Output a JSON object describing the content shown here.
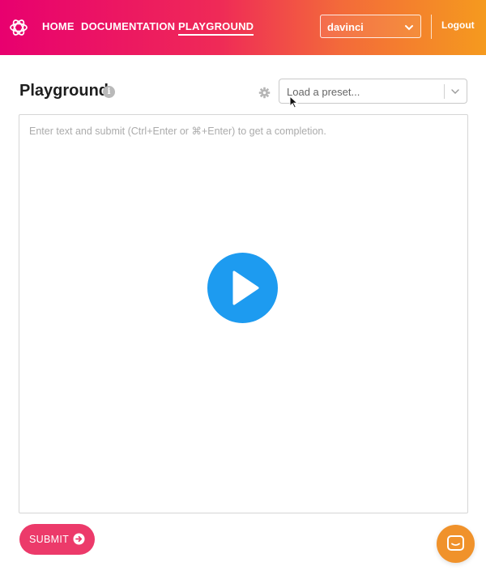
{
  "nav": {
    "links": [
      "HOME",
      "DOCUMENTATION",
      "PLAYGROUND"
    ],
    "active": "PLAYGROUND",
    "model": "davinci",
    "logout": "Logout"
  },
  "page": {
    "title": "Playground",
    "info_icon_glyph": "i",
    "preset_placeholder": "Load a preset..."
  },
  "editor": {
    "placeholder": "Enter text and submit (Ctrl+Enter or ⌘+Enter) to get a completion.",
    "value": ""
  },
  "actions": {
    "submit_label": "SUBMIT"
  },
  "colors": {
    "accent_pink": "#ec3a6a",
    "play_blue": "#1d9bf0",
    "chat_orange": "#f0922b"
  },
  "icons": [
    "openai-logo-icon",
    "chevron-down-icon",
    "info-icon",
    "gear-icon",
    "play-icon",
    "arrow-right-circle-icon",
    "chat-icon",
    "mouse-cursor-icon"
  ]
}
